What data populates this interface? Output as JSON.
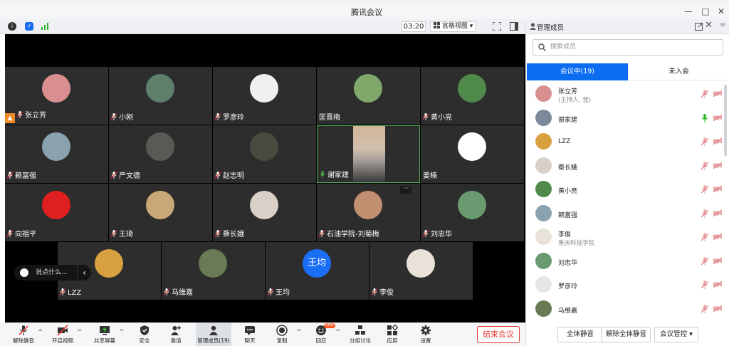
{
  "window": {
    "title": "腾讯会议",
    "minimize_glyph": "—",
    "maximize_glyph": "□",
    "close_glyph": "✕"
  },
  "meeting_toolbar": {
    "icons": [
      "info-icon",
      "shield-icon",
      "signal-icon"
    ],
    "timer": "03:20",
    "view_label": "宫格视图",
    "view_caret": "▾"
  },
  "video_grid": {
    "tiles": [
      {
        "name": "张立芳",
        "muted": true,
        "host": true,
        "avatar_color": "#d98f8f"
      },
      {
        "name": "小刚",
        "muted": true,
        "avatar_color": "#5f7f6a"
      },
      {
        "name": "罗彦玲",
        "muted": true,
        "avatar_color": "#f0f0f0"
      },
      {
        "name": "匡晋梅",
        "muted": false,
        "avatar_color": "#7fa86a"
      },
      {
        "name": "黄小亮",
        "muted": true,
        "avatar_color": "#4f8a4a"
      },
      {
        "name": "赖富强",
        "muted": true,
        "avatar_color": "#8aa2b0"
      },
      {
        "name": "严文德",
        "muted": true,
        "avatar_color": "#5a5a55"
      },
      {
        "name": "赵志明",
        "muted": true,
        "avatar_color": "#4a4a40"
      },
      {
        "name": "谢家建",
        "muted": false,
        "speaking": true,
        "camera": true
      },
      {
        "name": "姜楠",
        "muted": false,
        "avatar_color": "#ffffff"
      },
      {
        "name": "向祖平",
        "muted": true,
        "avatar_color": "#e02020"
      },
      {
        "name": "王琦",
        "muted": true,
        "avatar_color": "#c9a878"
      },
      {
        "name": "蔡长娥",
        "muted": true,
        "avatar_color": "#d9d0c8"
      },
      {
        "name": "石油学院-刘菊梅",
        "muted": true,
        "avatar_color": "#c09070",
        "more": "···"
      },
      {
        "name": "刘忠华",
        "muted": true,
        "avatar_color": "#6a9a70"
      },
      {
        "name": "LZZ",
        "muted": true,
        "avatar_color": "#d9a040"
      },
      {
        "name": "马维嘉",
        "muted": true,
        "avatar_color": "#6a7a55"
      },
      {
        "name": "王均",
        "muted": true,
        "avatar_text": "王均",
        "avatar_color": "#1a6ef5"
      },
      {
        "name": "李俊",
        "muted": true,
        "avatar_color": "#e8e2d8"
      }
    ],
    "chat_placeholder": "说点什么...",
    "chat_collapse": "‹"
  },
  "bottom_toolbar": {
    "buttons": [
      {
        "label": "解除静音",
        "icon": "mic-muted-icon",
        "caret": "^"
      },
      {
        "label": "开启视频",
        "icon": "video-off-icon",
        "caret": "^"
      },
      {
        "label": "共享屏幕",
        "icon": "share-screen-icon",
        "caret": "^"
      },
      {
        "label": "安全",
        "icon": "shield-icon"
      },
      {
        "label": "邀请",
        "icon": "invite-icon"
      },
      {
        "label": "管理成员(19)",
        "icon": "members-icon",
        "selected": true
      },
      {
        "label": "聊天",
        "icon": "chat-icon"
      },
      {
        "label": "录制",
        "icon": "record-icon",
        "caret": "^"
      },
      {
        "label": "回应",
        "icon": "reaction-icon",
        "caret": "^",
        "badge": "NEW"
      },
      {
        "label": "分组讨论",
        "icon": "breakout-icon"
      },
      {
        "label": "应用",
        "icon": "apps-icon"
      },
      {
        "label": "设置",
        "icon": "settings-icon"
      }
    ],
    "end_label": "结束会议"
  },
  "side_panel": {
    "title": "管理成员",
    "search_placeholder": "搜索成员",
    "tab_in_meeting": "会议中(19)",
    "tab_not_joined": "未入会",
    "members": [
      {
        "name": "张立芳",
        "sub": "(主持人, 我)",
        "mic": "muted",
        "avatar_color": "#d98f8f"
      },
      {
        "name": "谢家建",
        "sub": "",
        "mic": "on",
        "avatar_color": "#7a8a9a"
      },
      {
        "name": "LZZ",
        "sub": "",
        "mic": "muted",
        "avatar_color": "#d9a040"
      },
      {
        "name": "蔡长娥",
        "sub": "",
        "mic": "muted",
        "avatar_color": "#d9d0c8"
      },
      {
        "name": "黄小亮",
        "sub": "",
        "mic": "muted",
        "avatar_color": "#4f8a4a"
      },
      {
        "name": "赖富强",
        "sub": "",
        "mic": "muted",
        "avatar_color": "#8aa2b0"
      },
      {
        "name": "李俊",
        "sub": "重庆科技学院",
        "mic": "muted",
        "avatar_color": "#e8e2d8"
      },
      {
        "name": "刘忠华",
        "sub": "",
        "mic": "muted",
        "avatar_color": "#6a9a70"
      },
      {
        "name": "罗彦玲",
        "sub": "",
        "mic": "muted",
        "avatar_color": "#e6e6e6"
      },
      {
        "name": "马维嘉",
        "sub": "",
        "mic": "muted",
        "avatar_color": "#6a7a55"
      }
    ],
    "btn_mute_all": "全体静音",
    "btn_unmute_all": "解除全体静音",
    "btn_control": "会议管控 ▾"
  },
  "colors": {
    "accent": "#0a6cf1",
    "danger": "#e53935",
    "tile_bg": "#2d2d2d",
    "speaking": "#4caf50"
  }
}
